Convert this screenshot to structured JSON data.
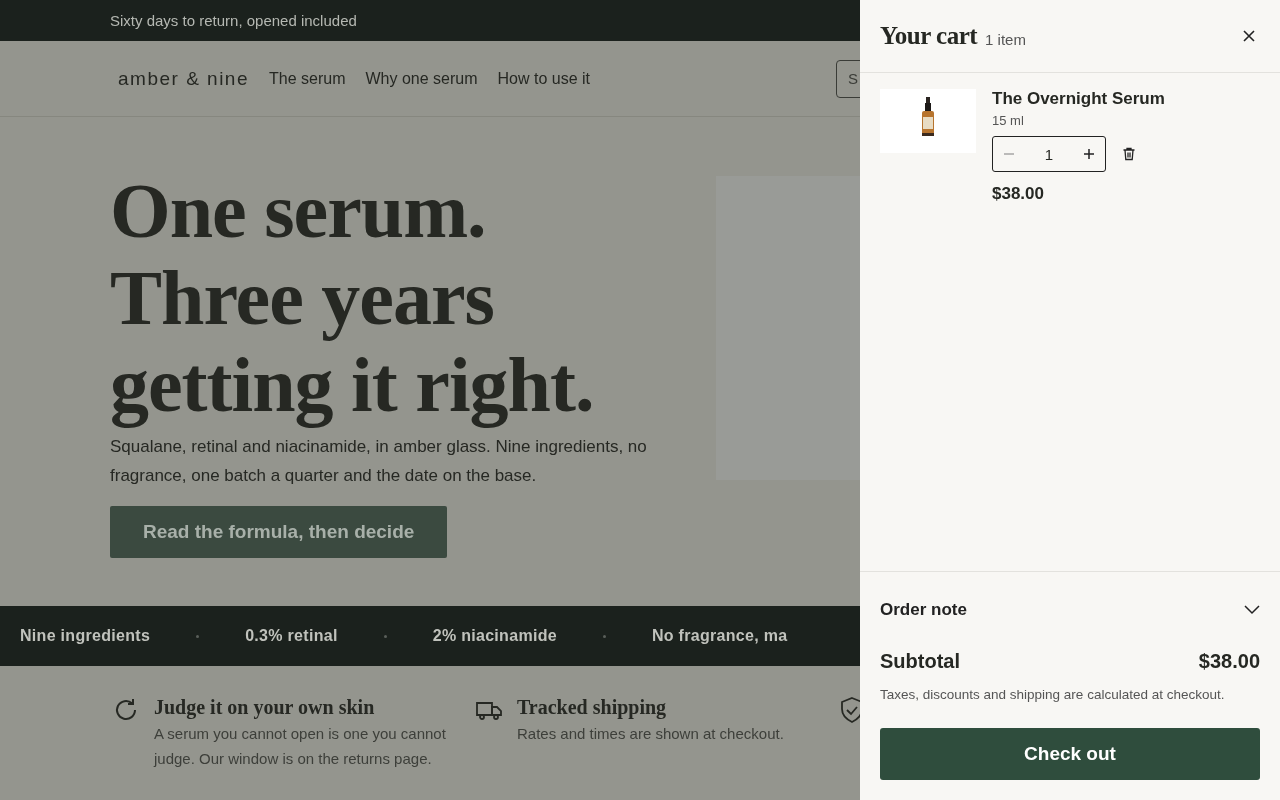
{
  "announcement": "Sixty days to return, opened included",
  "header": {
    "logo": "amber & nine",
    "nav": [
      "The serum",
      "Why one serum",
      "How to use it"
    ],
    "search": {
      "placeholder": "S"
    }
  },
  "hero": {
    "title_lines": [
      "One serum.",
      "Three years",
      "getting it right."
    ],
    "text": "Squalane, retinal and niacinamide, in amber glass. Nine ingredients, no fragrance, one batch a quarter and the date on the base.",
    "button": "Read the formula, then decide"
  },
  "marquee": [
    "Nine ingredients",
    "0.3% retinal",
    "2% niacinamide",
    "No fragrance, ma"
  ],
  "features": [
    {
      "kind": "returns",
      "title": "Judge it on your own skin",
      "text": "A serum you cannot open is one you cannot judge. Our window is on the returns page."
    },
    {
      "kind": "shipping",
      "title": "Tracked shipping",
      "text": "Rates and times are shown at checkout."
    },
    {
      "kind": "shield"
    }
  ],
  "cart": {
    "title": "Your cart",
    "count": "1 item",
    "items": [
      {
        "name": "The Overnight Serum",
        "variant": "15 ml",
        "quantity": "1",
        "price": "$38.00"
      }
    ],
    "order_note": {
      "label": "Order note",
      "expanded": false
    },
    "subtotal_label": "Subtotal",
    "subtotal": "$38.00",
    "note": "Taxes, discounts and shipping are calculated at checkout.",
    "checkout": "Check out"
  }
}
